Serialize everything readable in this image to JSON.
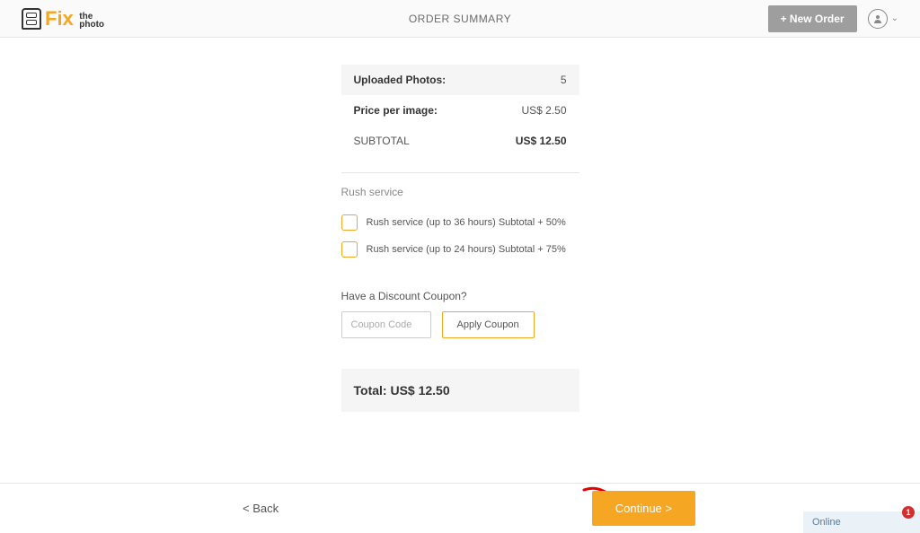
{
  "header": {
    "title": "ORDER SUMMARY",
    "new_order": "+ New Order"
  },
  "logo": {
    "fix": "Fix",
    "the": "the",
    "photo": "photo"
  },
  "summary": {
    "uploaded_label": "Uploaded Photos:",
    "uploaded_value": "5",
    "price_label": "Price per image:",
    "price_value": "US$ 2.50",
    "subtotal_label": "SUBTOTAL",
    "subtotal_value": "US$ 12.50"
  },
  "rush": {
    "title": "Rush service",
    "option1": "Rush service (up to 36 hours) Subtotal + 50%",
    "option2": "Rush service (up to 24 hours) Subtotal + 75%"
  },
  "coupon": {
    "title": "Have a Discount Coupon?",
    "placeholder": "Coupon Code",
    "apply": "Apply Coupon"
  },
  "total": {
    "label": "Total: US$ 12.50"
  },
  "footer": {
    "back": "< Back",
    "continue": "Continue >"
  },
  "chat": {
    "status": "Online",
    "badge": "1"
  }
}
